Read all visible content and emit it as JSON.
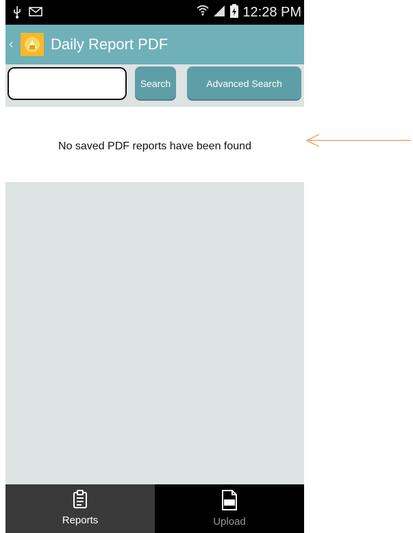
{
  "status_bar": {
    "time": "12:28 PM",
    "icons": [
      "usb-icon",
      "message-icon",
      "wifi-icon",
      "signal-icon",
      "battery-icon"
    ]
  },
  "action_bar": {
    "title": "Daily Report PDF",
    "back_icon": "chevron-left-icon",
    "app_icon": "daily-report-app-icon"
  },
  "search": {
    "value": "",
    "search_label": "Search",
    "advanced_label": "Advanced Search"
  },
  "content": {
    "empty_message": "No saved PDF reports have been found"
  },
  "tabs": [
    {
      "label": "Reports",
      "icon": "clipboard-icon",
      "active": true
    },
    {
      "label": "Upload",
      "icon": "pdf-file-icon",
      "active": false
    }
  ],
  "colors": {
    "action_bar": "#6fb0b9",
    "button": "#5e9ea7",
    "background": "#dde3e3",
    "annotation_arrow": "#f0a070"
  }
}
